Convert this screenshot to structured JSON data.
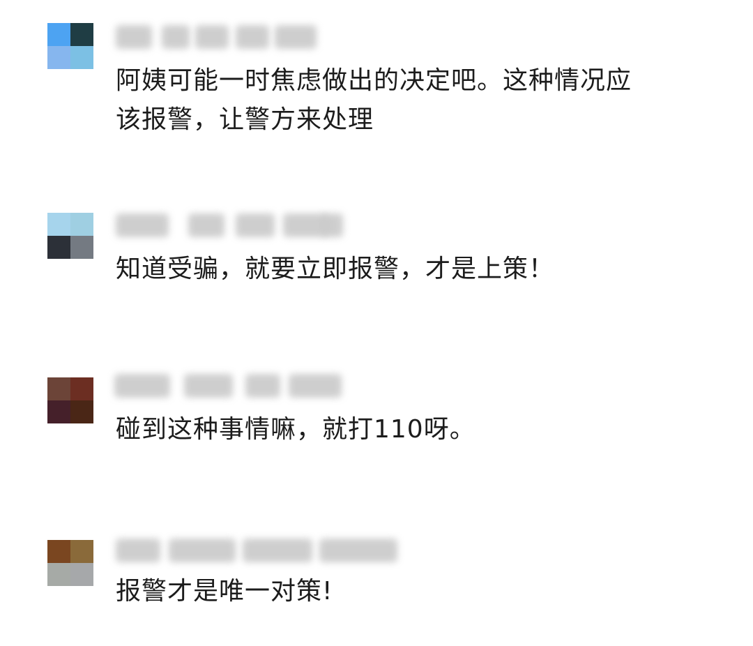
{
  "comments": [
    {
      "avatar_colors": [
        "#4da3f2",
        "#1f3d44",
        "#86b6ee",
        "#7cc0e4"
      ],
      "text": "阿姨可能一时焦虑做出的决定吧。这种情况应\n该报警，让警方来处理"
    },
    {
      "avatar_colors": [
        "#a6d4ec",
        "#9fcfe2",
        "#2c3038",
        "#747a82"
      ],
      "text": "知道受骗，就要立即报警，才是上策！"
    },
    {
      "avatar_colors": [
        "#6c4438",
        "#6c2e22",
        "#45202a",
        "#4a2616"
      ],
      "text": "碰到这种事情嘛，就打110呀。"
    },
    {
      "avatar_colors": [
        "#7a4620",
        "#8a6a3a",
        "#a6aaa6",
        "#a6a8aa"
      ],
      "text": "报警才是唯一对策!"
    }
  ]
}
